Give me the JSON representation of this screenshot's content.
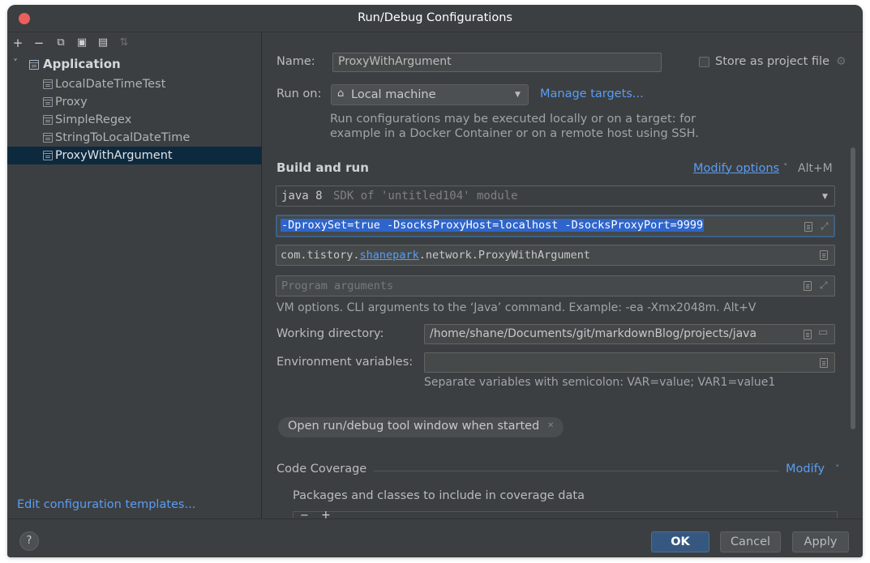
{
  "window": {
    "title": "Run/Debug Configurations"
  },
  "left_toolbar": {
    "icons": [
      "add-icon",
      "remove-icon",
      "copy-icon",
      "save-icon",
      "new-folder-icon",
      "sort-icon"
    ],
    "glyphs": [
      "+",
      "−",
      "⧉",
      "▣",
      "▤",
      "⇅"
    ]
  },
  "tree": {
    "root_label": "Application",
    "items": [
      {
        "label": "LocalDateTimeTest"
      },
      {
        "label": "Proxy"
      },
      {
        "label": "SimpleRegex"
      },
      {
        "label": "StringToLocalDateTime"
      },
      {
        "label": "ProxyWithArgument"
      }
    ],
    "selected_index": 4
  },
  "edit_templates_link": "Edit configuration templates...",
  "form": {
    "name_label": "Name:",
    "name_value": "ProxyWithArgument",
    "store_label": "Store as project file",
    "run_on_label": "Run on:",
    "run_on_value": "Local machine",
    "manage_targets": "Manage targets...",
    "run_on_hint_1": "Run configurations may be executed locally or on a target: for",
    "run_on_hint_2": "example in a Docker Container or on a remote host using SSH.",
    "build_run_title": "Build and run",
    "modify_options": "Modify options",
    "modify_shortcut": "Alt+M",
    "jdk_main": "java 8",
    "jdk_sub": "SDK of 'untitled104' module",
    "vm_options": "-DproxySet=true -DsocksProxyHost=localhost -DsocksProxyPort=9999",
    "main_class_prefix": "com.tistory.",
    "main_class_link": "shanepark",
    "main_class_suffix": ".network.ProxyWithArgument",
    "program_args_placeholder": "Program arguments",
    "vm_hint": "VM options. CLI arguments to the ‘Java’ command. Example: -ea -Xmx2048m. Alt+V",
    "working_dir_label": "Working directory:",
    "working_dir_value": "/home/shane/Documents/git/markdownBlog/projects/java",
    "env_label": "Environment variables:",
    "env_value": "",
    "env_hint": "Separate variables with semicolon: VAR=value; VAR1=value1",
    "tag_label": "Open run/debug tool window when started",
    "coverage_title": "Code Coverage",
    "coverage_modify": "Modify",
    "coverage_packages": "Packages and classes to include in coverage data"
  },
  "buttons": {
    "help": "?",
    "ok": "OK",
    "cancel": "Cancel",
    "apply": "Apply"
  },
  "colors": {
    "background": "#3c3f41",
    "accent": "#589df6",
    "selection": "#0d293e",
    "primary_button": "#365880",
    "vm_selection": "#2f65ca"
  }
}
